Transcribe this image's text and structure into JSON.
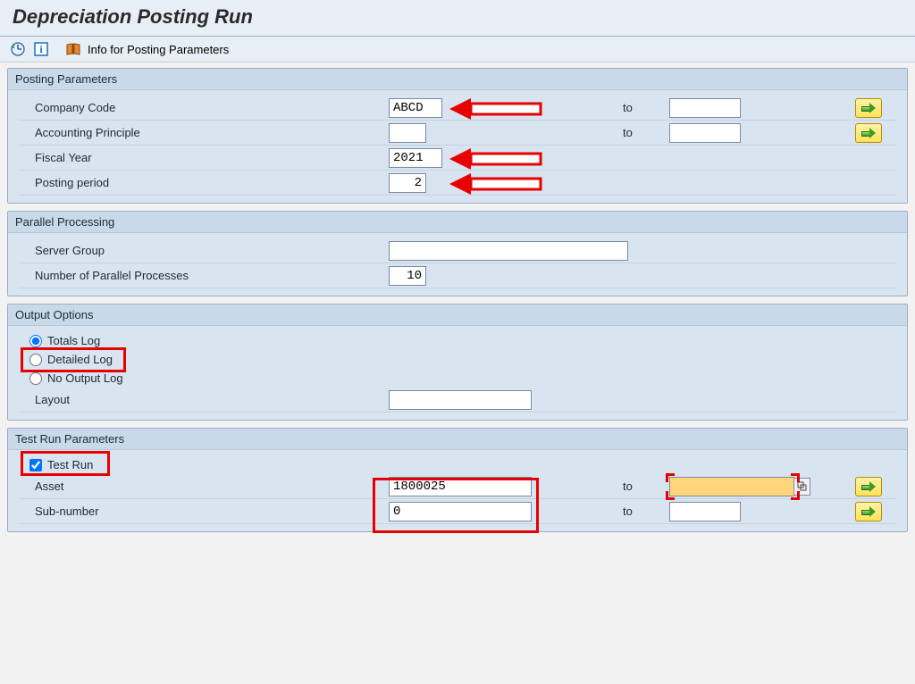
{
  "title": "Depreciation Posting Run",
  "toolbar": {
    "info_label": "Info for Posting Parameters"
  },
  "groups": {
    "posting": {
      "title": "Posting Parameters",
      "company_code_label": "Company Code",
      "company_code_value": "ABCD",
      "company_code_to_label": "to",
      "company_code_to_value": "",
      "acct_principle_label": "Accounting Principle",
      "acct_principle_value": "",
      "acct_principle_to_label": "to",
      "acct_principle_to_value": "",
      "fiscal_year_label": "Fiscal Year",
      "fiscal_year_value": "2021",
      "posting_period_label": "Posting period",
      "posting_period_value": "2"
    },
    "parallel": {
      "title": "Parallel Processing",
      "server_group_label": "Server Group",
      "server_group_value": "",
      "num_processes_label": "Number of Parallel Processes",
      "num_processes_value": "10"
    },
    "output": {
      "title": "Output Options",
      "totals_label": "Totals Log",
      "detailed_label": "Detailed Log",
      "nolog_label": "No Output Log",
      "selected": "totals",
      "layout_label": "Layout",
      "layout_value": ""
    },
    "testrun": {
      "title": "Test Run Parameters",
      "testrun_label": "Test Run",
      "testrun_checked": true,
      "asset_label": "Asset",
      "asset_value": "1800025",
      "asset_to_label": "to",
      "asset_to_value": "",
      "subnumber_label": "Sub-number",
      "subnumber_value": "0",
      "subnumber_to_label": "to",
      "subnumber_to_value": ""
    }
  }
}
